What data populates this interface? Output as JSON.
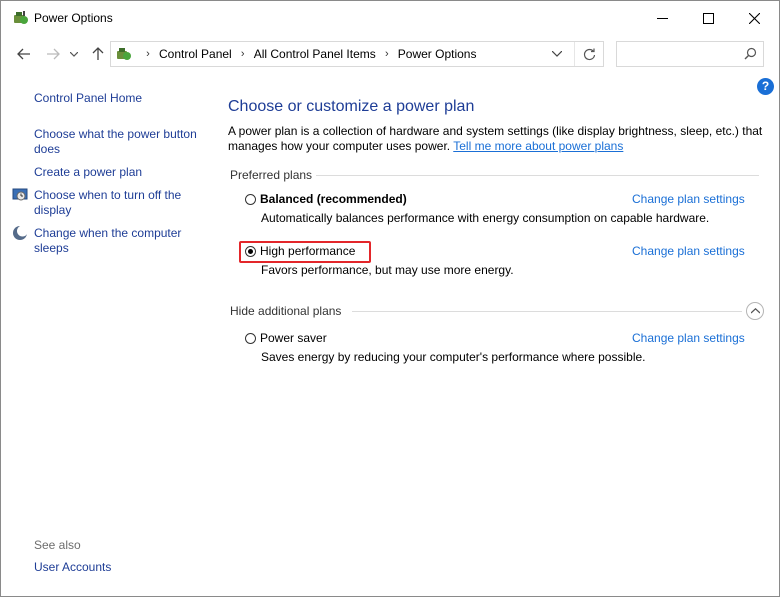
{
  "window": {
    "title": "Power Options"
  },
  "address": {
    "crumbs": [
      "Control Panel",
      "All Control Panel Items",
      "Power Options"
    ],
    "search_placeholder": ""
  },
  "help": {
    "label": "?"
  },
  "left_pane": {
    "home": "Control Panel Home",
    "links": [
      "Choose what the power button does",
      "Create a power plan",
      "Choose when to turn off the display",
      "Change when the computer sleeps"
    ],
    "see_also_label": "See also",
    "see_also_links": [
      "User Accounts"
    ]
  },
  "main": {
    "title": "Choose or customize a power plan",
    "description": "A power plan is a collection of hardware and system settings (like display brightness, sleep, etc.) that manages how your computer uses power.",
    "learn_more": "Tell me more about power plans",
    "preferred_label": "Preferred plans",
    "hide_label": "Hide additional plans",
    "change_label": "Change plan settings",
    "plans": [
      {
        "name": "Balanced (recommended)",
        "desc": "Automatically balances performance with energy consumption on capable hardware.",
        "selected": false
      },
      {
        "name": "High performance",
        "desc": "Favors performance, but may use more energy.",
        "selected": true
      },
      {
        "name": "Power saver",
        "desc": "Saves energy by reducing your computer's performance where possible.",
        "selected": false
      }
    ]
  },
  "colors": {
    "link": "#1a6fd6",
    "nav_link": "#1e3d96",
    "highlight": "#e3262a"
  }
}
